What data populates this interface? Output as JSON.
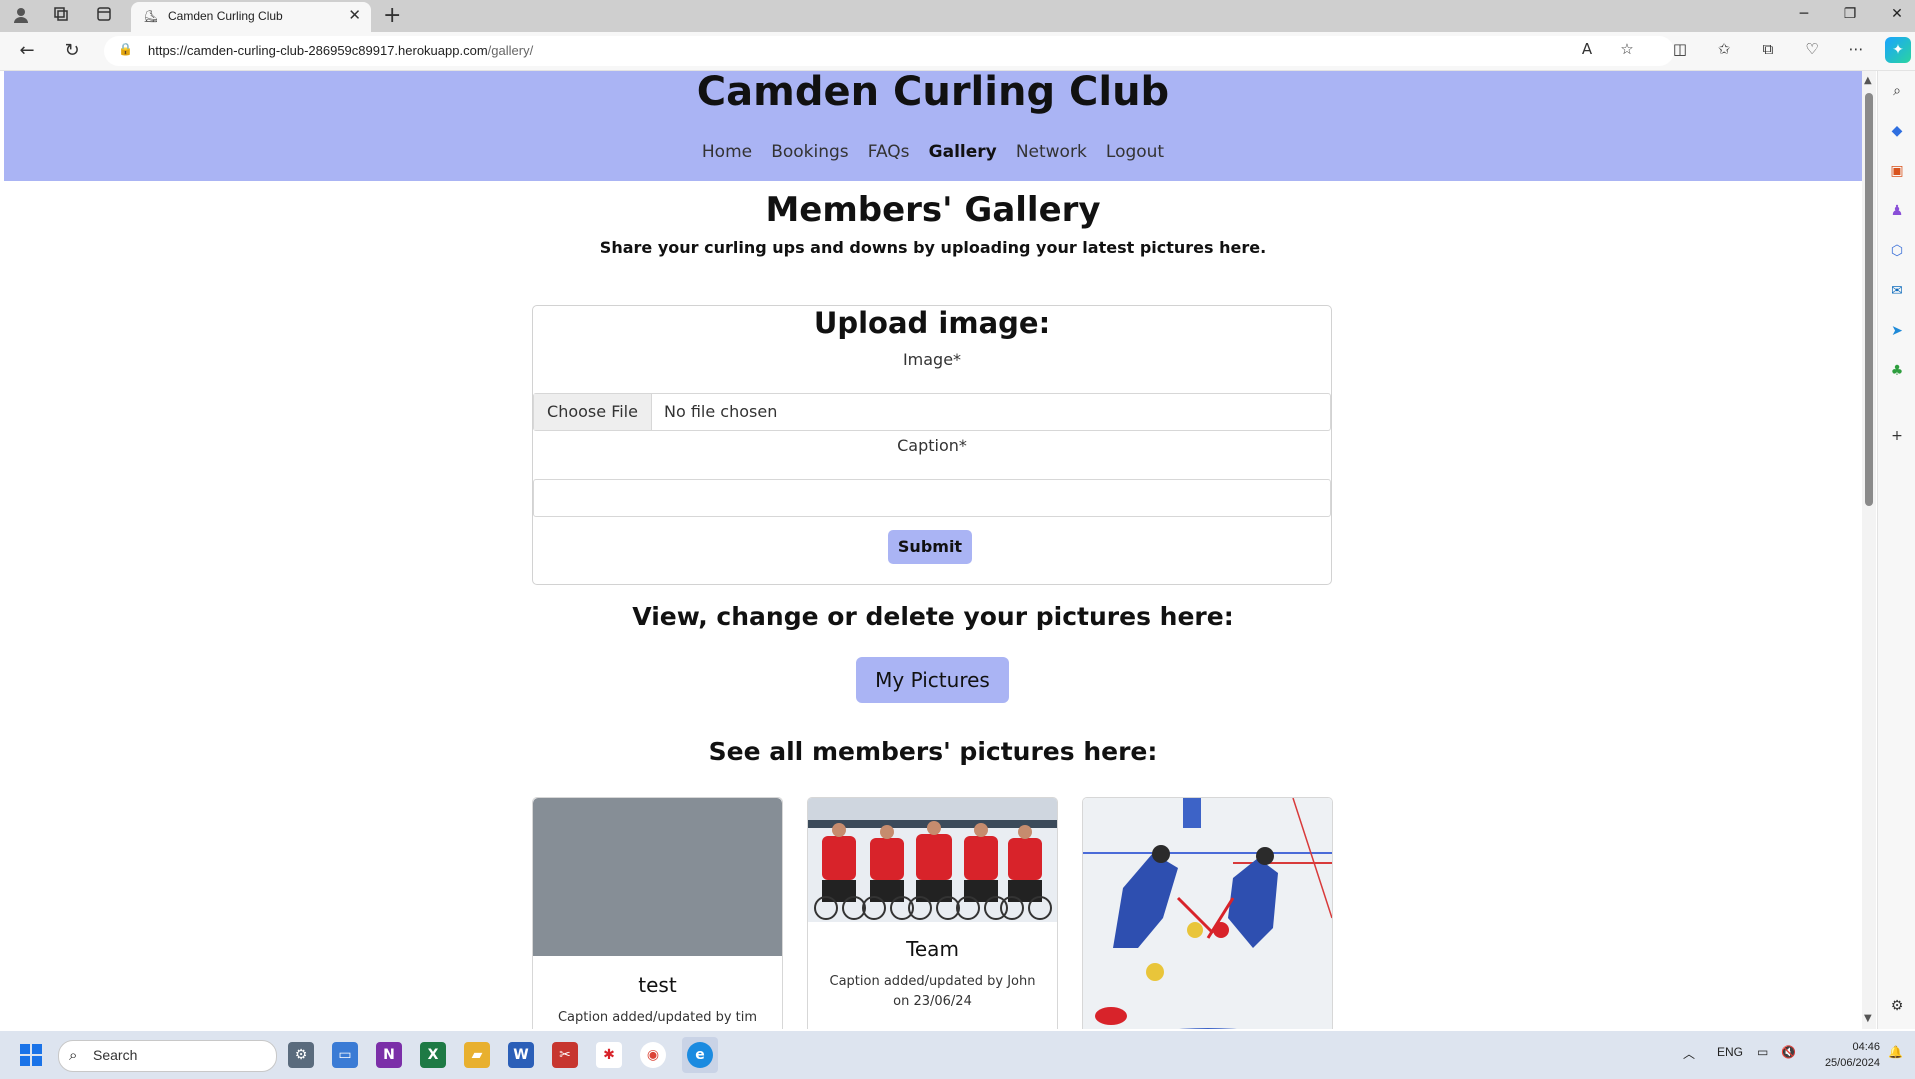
{
  "browser": {
    "tab_title": "Camden Curling Club",
    "url_host": "https://camden-curling-club-286959c89917.herokuapp.com",
    "url_path": "/gallery/"
  },
  "site": {
    "title": "Camden Curling Club",
    "nav": [
      {
        "label": "Home",
        "active": false
      },
      {
        "label": "Bookings",
        "active": false
      },
      {
        "label": "FAQs",
        "active": false
      },
      {
        "label": "Gallery",
        "active": true
      },
      {
        "label": "Network",
        "active": false
      },
      {
        "label": "Logout",
        "active": false
      }
    ],
    "header_color": "#aab4f4"
  },
  "gallery": {
    "heading": "Members' Gallery",
    "subheading": "Share your curling ups and downs by uploading your latest pictures here."
  },
  "upload": {
    "title": "Upload image:",
    "image_label": "Image*",
    "file_button": "Choose File",
    "file_status": "No file chosen",
    "caption_label": "Caption*",
    "caption_value": "",
    "submit_label": "Submit"
  },
  "my_pictures": {
    "heading": "View, change or delete your pictures here:",
    "button_label": "My Pictures"
  },
  "all_pictures": {
    "heading": "See all members' pictures here:",
    "cards": [
      {
        "title": "test",
        "caption": "Caption added/updated by tim",
        "image": "placeholder"
      },
      {
        "title": "Team",
        "caption": "Caption added/updated by John on 23/06/24",
        "image": "team-photo"
      },
      {
        "title": "",
        "caption": "",
        "image": "curling-sweepers-photo"
      }
    ]
  },
  "taskbar": {
    "search_placeholder": "Search",
    "language": "ENG",
    "time": "04:46",
    "date": "25/06/2024"
  }
}
